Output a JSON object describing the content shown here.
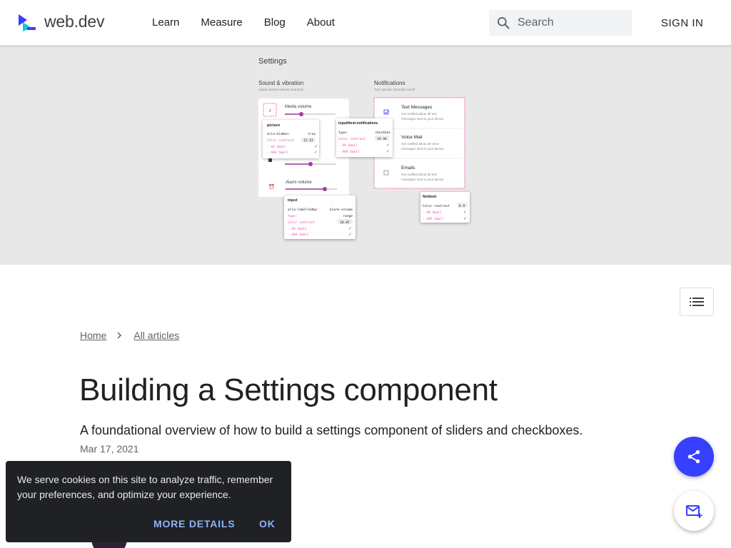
{
  "header": {
    "logo_text": "web.dev",
    "nav": [
      "Learn",
      "Measure",
      "Blog",
      "About"
    ],
    "search_placeholder": "Search",
    "signin_label": "SIGN IN"
  },
  "hero": {
    "heading": "Settings",
    "sound_title": "Sound & vibration",
    "sound_sub": "Adjust system volume channels",
    "notif_title": "Notifications",
    "notif_sub": "Turn specific channels on/off",
    "media_label": "Media volume",
    "alarm_label": "Alarm volume",
    "notif_items": [
      {
        "title": "Text Messages",
        "desc1": "Get notified about all text",
        "desc2": "messages sent to your device"
      },
      {
        "title": "Voice Mail",
        "desc1": "Get notified about all voice",
        "desc2": "messages sent to your device"
      },
      {
        "title": "Emails",
        "desc1": "Get notified about all text",
        "desc2": "messages sent to your device"
      }
    ],
    "tip_picture": {
      "title": "picture",
      "k1": "aria-hidden:",
      "v1": "true",
      "k2": "Color contrast",
      "v2": "12.53",
      "k3": "- AA Small",
      "k4": "- AAA Small"
    },
    "tip_text_notif": {
      "title": "input#text-notifications",
      "k1": "type:",
      "v1": "checkbox",
      "k2": "Color contrast",
      "v2": "19.94",
      "k3": "- AA Small",
      "k4": "- AAA Small"
    },
    "tip_input": {
      "title": "input",
      "k1": "aria-labelledby:",
      "v1": "alarm-volume",
      "k2": "type:",
      "v2": "range",
      "k3": "Color contrast",
      "v3": "18.07",
      "k4": "- AA Small",
      "k5": "- AAA Small"
    },
    "tip_fieldset": {
      "title": "fieldset",
      "k1": "Color contrast",
      "v1": "8.9",
      "k2": "- AA Small",
      "k3": "- AAA Small"
    },
    "colors": {
      "accent": "#a23ca4",
      "pink": "#e94da9",
      "check": "#188038"
    }
  },
  "breadcrumb": {
    "home": "Home",
    "all_articles": "All articles"
  },
  "article": {
    "title": "Building a Settings component",
    "subtitle": "A foundational overview of how to build a settings component of sliders and checkboxes.",
    "date": "Mar 17, 2021"
  },
  "cookie": {
    "text": "We serve cookies on this site to analyze traffic, remember your preferences, and optimize your experience.",
    "more_label": "MORE DETAILS",
    "ok_label": "OK"
  },
  "icons": {
    "logo": "webdev-logo-icon",
    "search": "search-icon",
    "toc": "list-icon",
    "chevron": "chevron-right-icon",
    "share": "share-icon",
    "mail": "mail-add-icon"
  },
  "colors": {
    "brand_blue": "#3740ff",
    "logo_cyan": "#00c9db",
    "cookie_bg": "#202124",
    "cookie_link": "#8ab4f8"
  }
}
